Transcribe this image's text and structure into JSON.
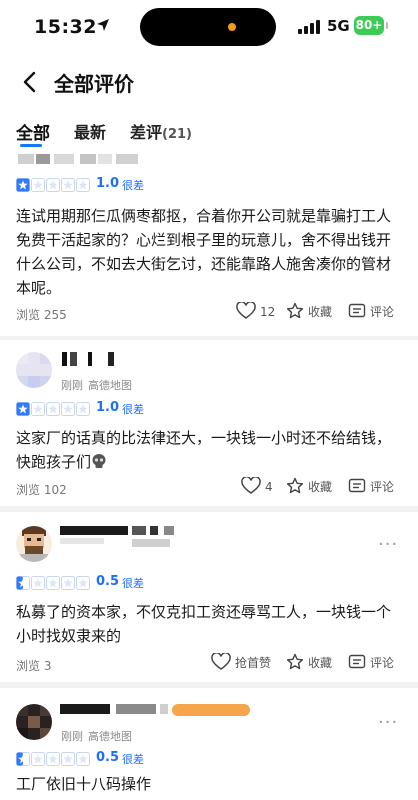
{
  "status": {
    "time": "15:32",
    "network": "5G",
    "battery": "80+"
  },
  "header": {
    "title": "全部评价"
  },
  "tabs": [
    {
      "label": "全部"
    },
    {
      "label": "最新"
    },
    {
      "label": "差评",
      "count": "(21)"
    }
  ],
  "reviews": [
    {
      "score": "1.0",
      "score_label": "很差",
      "rating": 1,
      "text": "连试用期那仨瓜俩枣都抠，合着你开公司就是靠骗打工人免费干活起家的？心烂到根子里的玩意儿，舍不得出钱开什么公司，不如去大街乞讨，还能靠路人施舍凑你的管材本呢。",
      "views": "浏览 255",
      "actions": {
        "like": "12",
        "fav": "收藏",
        "comment": "评论"
      }
    },
    {
      "meta_time": "刚刚",
      "meta_source": "高德地图",
      "score": "1.0",
      "score_label": "很差",
      "rating": 1,
      "text": "这家厂的话真的比法律还大，一块钱一小时还不给结钱，快跑孩子们",
      "views": "浏览 102",
      "actions": {
        "like": "4",
        "fav": "收藏",
        "comment": "评论"
      }
    },
    {
      "score": "0.5",
      "score_label": "很差",
      "rating": 0.5,
      "text": "私募了的资本家，不仅克扣工资还辱骂工人，一块钱一个小时找奴隶来的",
      "views": "浏览 3",
      "actions": {
        "like": "抢首赞",
        "fav": "收藏",
        "comment": "评论"
      }
    },
    {
      "meta_time": "刚刚",
      "meta_source": "高德地图",
      "score": "0.5",
      "score_label": "很差",
      "rating": 0.5,
      "text": "工厂依旧十八码操作"
    }
  ],
  "colors": {
    "accent": "#1677ff",
    "score": "#1f6dff",
    "star": "#2f7bff"
  }
}
